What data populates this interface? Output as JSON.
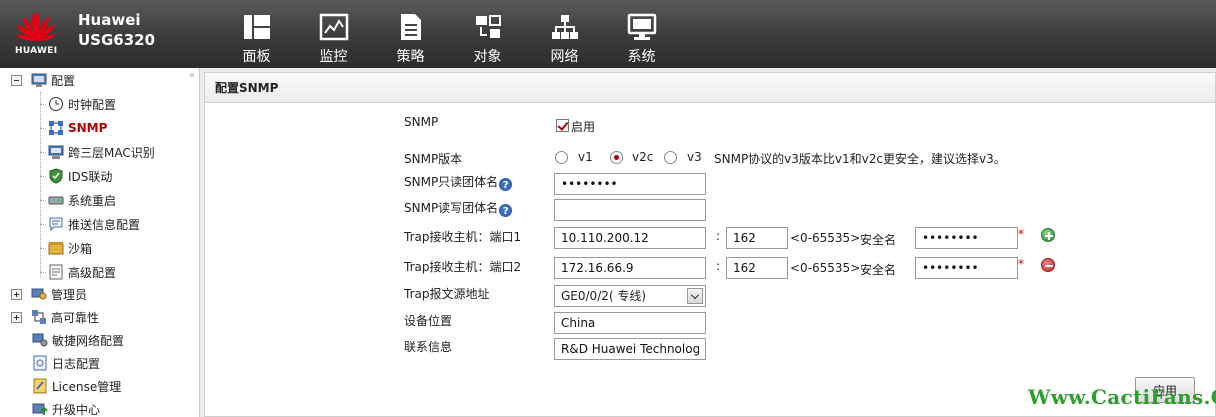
{
  "header": {
    "brand": "HUAWEI",
    "product_line1": "Huawei",
    "product_line2": "USG6320",
    "nav": [
      {
        "label": "面板",
        "icon": "dashboard-icon"
      },
      {
        "label": "监控",
        "icon": "monitor-chart-icon"
      },
      {
        "label": "策略",
        "icon": "policy-document-icon"
      },
      {
        "label": "对象",
        "icon": "object-icon"
      },
      {
        "label": "网络",
        "icon": "network-icon"
      },
      {
        "label": "系统",
        "icon": "system-monitor-icon"
      }
    ]
  },
  "sidebar": {
    "collapse": "«",
    "root": {
      "label": "配置"
    },
    "children": [
      {
        "label": "时钟配置",
        "icon": "clock-icon"
      },
      {
        "label": "SNMP",
        "icon": "snmp-icon",
        "active": true
      },
      {
        "label": "跨三层MAC识别",
        "icon": "mac-identify-icon"
      },
      {
        "label": "IDS联动",
        "icon": "ids-shield-icon"
      },
      {
        "label": "系统重启",
        "icon": "restart-icon"
      },
      {
        "label": "推送信息配置",
        "icon": "push-message-icon"
      },
      {
        "label": "沙箱",
        "icon": "sandbox-icon"
      },
      {
        "label": "高级配置",
        "icon": "advanced-config-icon"
      }
    ],
    "others": [
      {
        "label": "管理员",
        "expandable": true,
        "icon": "admin-icon"
      },
      {
        "label": "高可靠性",
        "expandable": true,
        "icon": "ha-icon"
      },
      {
        "label": "敏捷网络配置",
        "expandable": false,
        "icon": "agile-network-icon"
      },
      {
        "label": "日志配置",
        "expandable": false,
        "icon": "log-config-icon"
      },
      {
        "label": "License管理",
        "expandable": false,
        "icon": "license-icon"
      },
      {
        "label": "升级中心",
        "expandable": false,
        "icon": "upgrade-icon"
      }
    ]
  },
  "main": {
    "title": "配置SNMP",
    "snmp_label": "SNMP",
    "enable_label": "启用",
    "version_label": "SNMP版本",
    "versions": [
      "v1",
      "v2c",
      "v3"
    ],
    "selected_version": "v2c",
    "version_tip": "SNMP协议的v3版本比v1和v2c更安全，建议选择v3。",
    "ro_community_label": "SNMP只读团体名",
    "ro_community_value": "••••••••",
    "rw_community_label": "SNMP读写团体名",
    "rw_community_value": "",
    "help_glyph": "?",
    "colon": ":",
    "trap_hosts": [
      {
        "label": "Trap接收主机：端口1",
        "host": "10.110.200.12",
        "port": "162",
        "range": "<0-65535>",
        "secname_label": "安全名",
        "secname": "••••••••",
        "req": "*"
      },
      {
        "label": "Trap接收主机：端口2",
        "host": "172.16.66.9",
        "port": "162",
        "range": "<0-65535>",
        "secname_label": "安全名",
        "secname": "••••••••",
        "req": "*"
      }
    ],
    "trap_source_label": "Trap报文源地址",
    "trap_source_value": "GE0/0/2(        专线)",
    "location_label": "设备位置",
    "location_value": "China",
    "contact_label": "联系信息",
    "contact_value": "R&D Huawei Technologies",
    "apply_label": "应用"
  },
  "watermark": "Www.CactiFans.Org"
}
